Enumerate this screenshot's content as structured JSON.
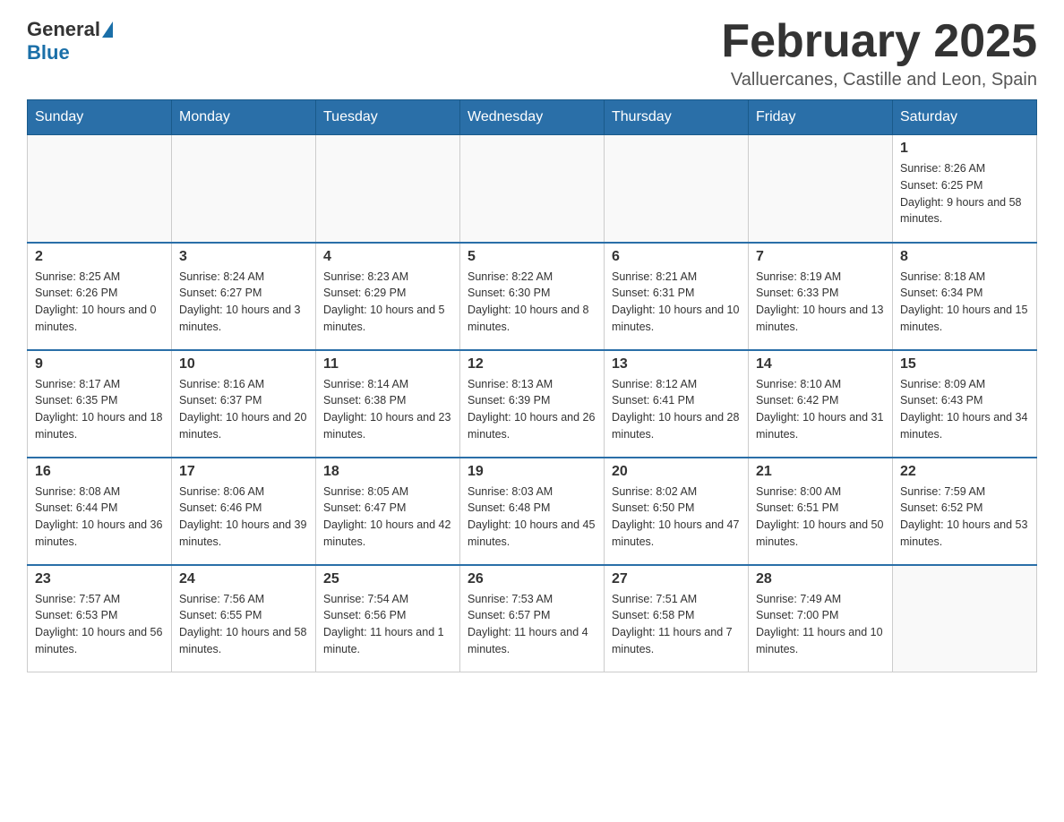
{
  "header": {
    "logo_general": "General",
    "logo_blue": "Blue",
    "month_title": "February 2025",
    "location": "Valluercanes, Castille and Leon, Spain"
  },
  "days_of_week": [
    "Sunday",
    "Monday",
    "Tuesday",
    "Wednesday",
    "Thursday",
    "Friday",
    "Saturday"
  ],
  "weeks": [
    [
      {
        "day": "",
        "info": ""
      },
      {
        "day": "",
        "info": ""
      },
      {
        "day": "",
        "info": ""
      },
      {
        "day": "",
        "info": ""
      },
      {
        "day": "",
        "info": ""
      },
      {
        "day": "",
        "info": ""
      },
      {
        "day": "1",
        "info": "Sunrise: 8:26 AM\nSunset: 6:25 PM\nDaylight: 9 hours and 58 minutes."
      }
    ],
    [
      {
        "day": "2",
        "info": "Sunrise: 8:25 AM\nSunset: 6:26 PM\nDaylight: 10 hours and 0 minutes."
      },
      {
        "day": "3",
        "info": "Sunrise: 8:24 AM\nSunset: 6:27 PM\nDaylight: 10 hours and 3 minutes."
      },
      {
        "day": "4",
        "info": "Sunrise: 8:23 AM\nSunset: 6:29 PM\nDaylight: 10 hours and 5 minutes."
      },
      {
        "day": "5",
        "info": "Sunrise: 8:22 AM\nSunset: 6:30 PM\nDaylight: 10 hours and 8 minutes."
      },
      {
        "day": "6",
        "info": "Sunrise: 8:21 AM\nSunset: 6:31 PM\nDaylight: 10 hours and 10 minutes."
      },
      {
        "day": "7",
        "info": "Sunrise: 8:19 AM\nSunset: 6:33 PM\nDaylight: 10 hours and 13 minutes."
      },
      {
        "day": "8",
        "info": "Sunrise: 8:18 AM\nSunset: 6:34 PM\nDaylight: 10 hours and 15 minutes."
      }
    ],
    [
      {
        "day": "9",
        "info": "Sunrise: 8:17 AM\nSunset: 6:35 PM\nDaylight: 10 hours and 18 minutes."
      },
      {
        "day": "10",
        "info": "Sunrise: 8:16 AM\nSunset: 6:37 PM\nDaylight: 10 hours and 20 minutes."
      },
      {
        "day": "11",
        "info": "Sunrise: 8:14 AM\nSunset: 6:38 PM\nDaylight: 10 hours and 23 minutes."
      },
      {
        "day": "12",
        "info": "Sunrise: 8:13 AM\nSunset: 6:39 PM\nDaylight: 10 hours and 26 minutes."
      },
      {
        "day": "13",
        "info": "Sunrise: 8:12 AM\nSunset: 6:41 PM\nDaylight: 10 hours and 28 minutes."
      },
      {
        "day": "14",
        "info": "Sunrise: 8:10 AM\nSunset: 6:42 PM\nDaylight: 10 hours and 31 minutes."
      },
      {
        "day": "15",
        "info": "Sunrise: 8:09 AM\nSunset: 6:43 PM\nDaylight: 10 hours and 34 minutes."
      }
    ],
    [
      {
        "day": "16",
        "info": "Sunrise: 8:08 AM\nSunset: 6:44 PM\nDaylight: 10 hours and 36 minutes."
      },
      {
        "day": "17",
        "info": "Sunrise: 8:06 AM\nSunset: 6:46 PM\nDaylight: 10 hours and 39 minutes."
      },
      {
        "day": "18",
        "info": "Sunrise: 8:05 AM\nSunset: 6:47 PM\nDaylight: 10 hours and 42 minutes."
      },
      {
        "day": "19",
        "info": "Sunrise: 8:03 AM\nSunset: 6:48 PM\nDaylight: 10 hours and 45 minutes."
      },
      {
        "day": "20",
        "info": "Sunrise: 8:02 AM\nSunset: 6:50 PM\nDaylight: 10 hours and 47 minutes."
      },
      {
        "day": "21",
        "info": "Sunrise: 8:00 AM\nSunset: 6:51 PM\nDaylight: 10 hours and 50 minutes."
      },
      {
        "day": "22",
        "info": "Sunrise: 7:59 AM\nSunset: 6:52 PM\nDaylight: 10 hours and 53 minutes."
      }
    ],
    [
      {
        "day": "23",
        "info": "Sunrise: 7:57 AM\nSunset: 6:53 PM\nDaylight: 10 hours and 56 minutes."
      },
      {
        "day": "24",
        "info": "Sunrise: 7:56 AM\nSunset: 6:55 PM\nDaylight: 10 hours and 58 minutes."
      },
      {
        "day": "25",
        "info": "Sunrise: 7:54 AM\nSunset: 6:56 PM\nDaylight: 11 hours and 1 minute."
      },
      {
        "day": "26",
        "info": "Sunrise: 7:53 AM\nSunset: 6:57 PM\nDaylight: 11 hours and 4 minutes."
      },
      {
        "day": "27",
        "info": "Sunrise: 7:51 AM\nSunset: 6:58 PM\nDaylight: 11 hours and 7 minutes."
      },
      {
        "day": "28",
        "info": "Sunrise: 7:49 AM\nSunset: 7:00 PM\nDaylight: 11 hours and 10 minutes."
      },
      {
        "day": "",
        "info": ""
      }
    ]
  ]
}
